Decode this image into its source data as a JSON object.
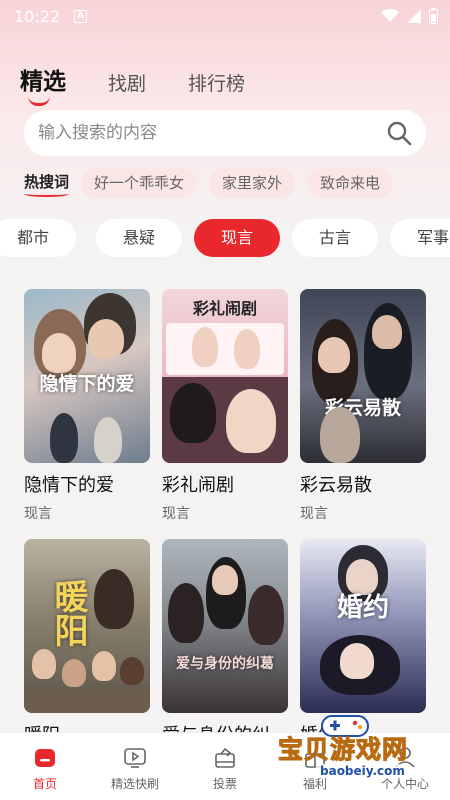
{
  "status": {
    "time": "10:22",
    "notif": "A"
  },
  "tabs": [
    {
      "label": "精选",
      "active": true
    },
    {
      "label": "找剧",
      "active": false
    },
    {
      "label": "排行榜",
      "active": false
    }
  ],
  "search": {
    "placeholder": "输入搜索的内容"
  },
  "hot": {
    "title": "热搜词",
    "chips": [
      "好一个乖乖女",
      "家里家外",
      "致命来电"
    ]
  },
  "categories": {
    "items": [
      "都市",
      "悬疑",
      "现言",
      "古言",
      "军事"
    ],
    "active": "现言"
  },
  "dramas": [
    {
      "title": "隐情下的爱",
      "genre": "现言",
      "poster_text": "隐情下的爱"
    },
    {
      "title": "彩礼闹剧",
      "genre": "现言",
      "poster_text": "彩礼闹剧"
    },
    {
      "title": "彩云易散",
      "genre": "现言",
      "poster_text": "彩云易散"
    },
    {
      "title": "暖阳",
      "genre": "",
      "poster_text": "暖阳"
    },
    {
      "title": "爱与身份的纠",
      "genre": "",
      "poster_text": "爱与身份的纠葛"
    },
    {
      "title": "婚约",
      "genre": "",
      "poster_text": "婚约"
    }
  ],
  "nav": [
    {
      "label": "首页",
      "icon": "home-icon",
      "active": true
    },
    {
      "label": "精选快刷",
      "icon": "play-icon",
      "active": false
    },
    {
      "label": "投票",
      "icon": "vote-icon",
      "active": false
    },
    {
      "label": "福利",
      "icon": "gift-icon",
      "active": false
    },
    {
      "label": "个人中心",
      "icon": "user-icon",
      "active": false
    }
  ],
  "watermark": {
    "text": "宝贝游戏网",
    "url": "baobeiy.com"
  },
  "colors": {
    "accent": "#e8282d",
    "chip_bg": "#fbe6e6"
  }
}
